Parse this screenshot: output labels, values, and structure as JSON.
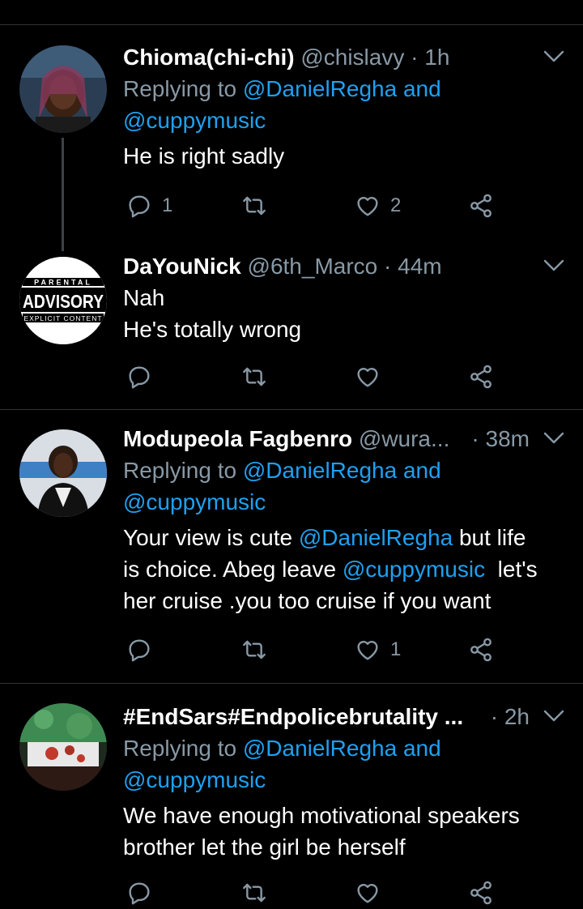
{
  "tweets": [
    {
      "name": "Chioma(chi-chi)",
      "handle": "@chislavy",
      "time": "· 1h",
      "reply_prefix": "Replying to ",
      "reply_mention1": "@DanielRegha",
      "reply_and": " and",
      "reply_mention2": "@cuppymusic",
      "text": "He is right sadly",
      "reply_count": "1",
      "like_count": "2"
    },
    {
      "name": "DaYouNick",
      "handle": "@6th_Marco",
      "time": "· 44m",
      "text_line1": "Nah",
      "text_line2": "He's totally wrong",
      "avatar_top": "PARENTAL",
      "avatar_mid": "ADVISORY",
      "avatar_bot": "EXPLICIT CONTENT"
    },
    {
      "name": "Modupeola Fagbenro",
      "handle": "@wura...",
      "time": "· 38m",
      "reply_prefix": "Replying to ",
      "reply_mention1": "@DanielRegha",
      "reply_and": " and",
      "reply_mention2": "@cuppymusic",
      "t1_a": "Your view is cute ",
      "t1_m": "@DanielRegha",
      "t1_b": " but life",
      "t2_a": "is choice. Abeg leave ",
      "t2_m": "@cuppymusic",
      "t2_b": "  let's",
      "t3": "her cruise .you too cruise if you want",
      "like_count": "1"
    },
    {
      "name": "#EndSars#Endpolicebrutality ...",
      "time": "· 2h",
      "reply_prefix": "Replying to ",
      "reply_mention1": "@DanielRegha",
      "reply_and": " and",
      "reply_mention2": "@cuppymusic",
      "text_line1": "We have enough motivational speakers",
      "text_line2": "brother let the girl be herself"
    }
  ],
  "colors": {
    "background": "#000000",
    "name": "#ffffff",
    "secondary": "#8899a6",
    "mention": "#1da1f2",
    "divider": "#2f3336"
  },
  "icons": [
    "reply-icon",
    "retweet-icon",
    "like-icon",
    "share-icon",
    "chevron-down-icon"
  ]
}
